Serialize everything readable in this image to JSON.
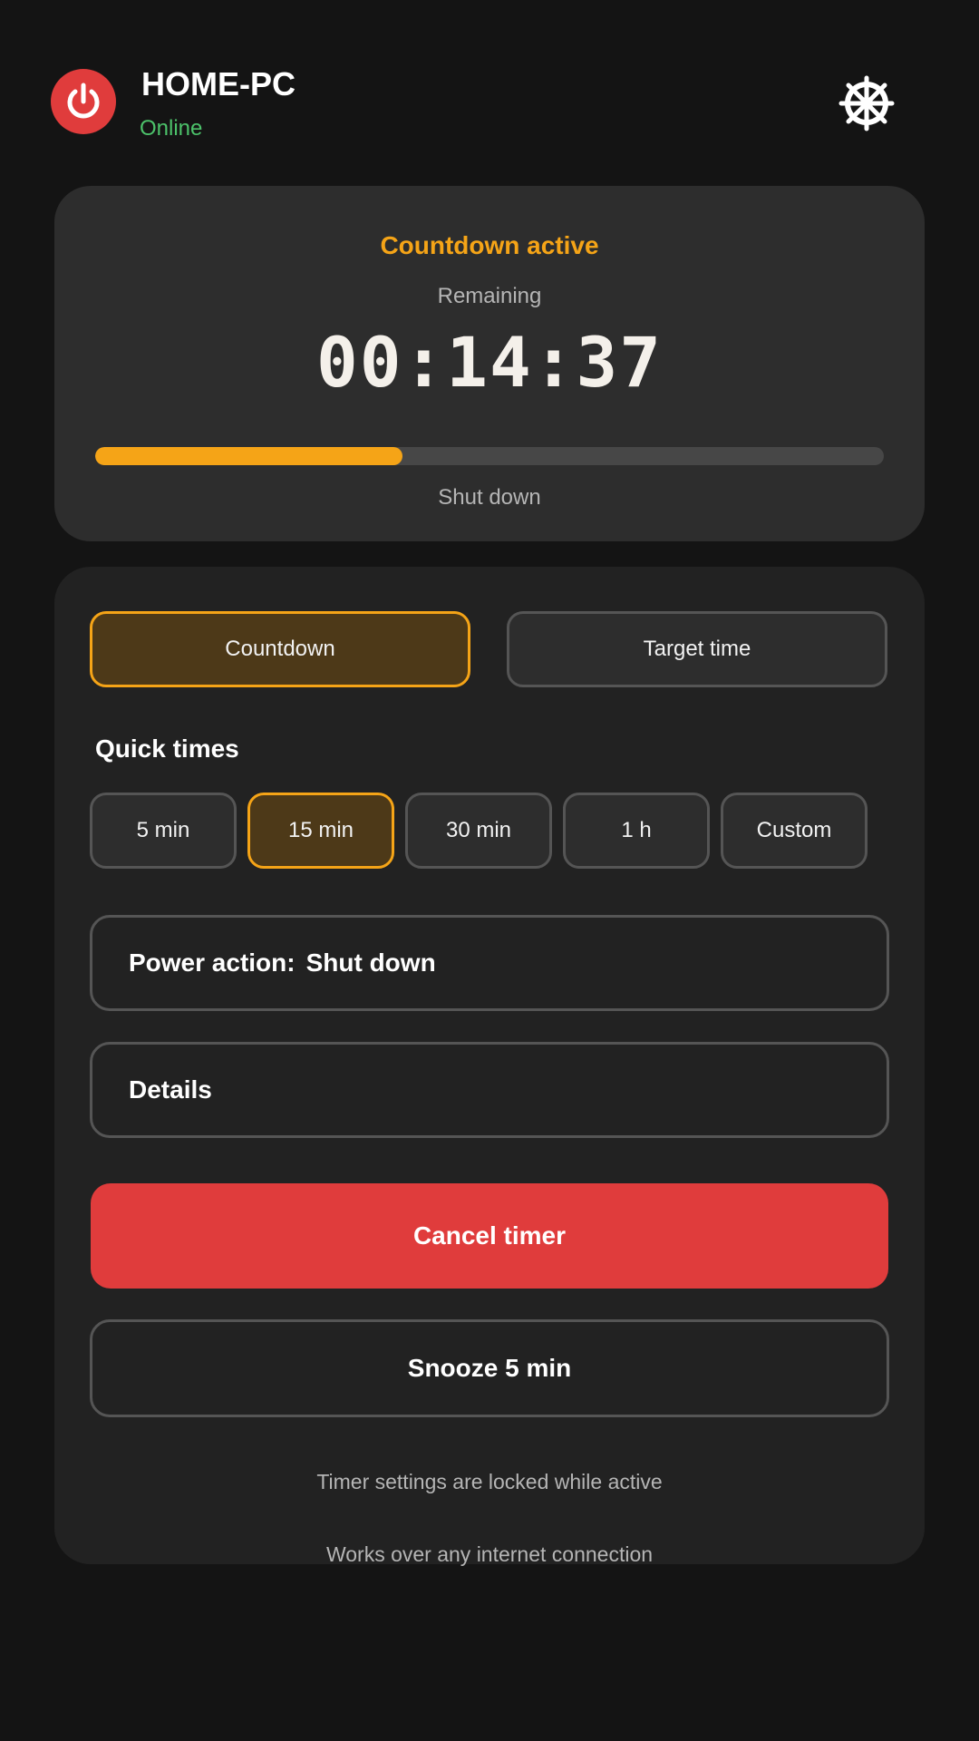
{
  "header": {
    "device_name": "HOME-PC",
    "status": "Online",
    "power_icon": "power-icon",
    "settings_icon": "gear-icon"
  },
  "status_card": {
    "title": "Countdown active",
    "remaining_label": "Remaining",
    "time": "00:14:37",
    "progress_percent": 39,
    "action": "Shut down"
  },
  "mode_tabs": [
    {
      "label": "Countdown",
      "selected": true
    },
    {
      "label": "Target time",
      "selected": false
    }
  ],
  "quick_times": {
    "title": "Quick times",
    "options": [
      {
        "label": "5 min",
        "selected": false
      },
      {
        "label": "15 min",
        "selected": true
      },
      {
        "label": "30 min",
        "selected": false
      },
      {
        "label": "1 h",
        "selected": false
      },
      {
        "label": "Custom",
        "selected": false
      }
    ]
  },
  "power_action": {
    "label": "Power action:",
    "value": "Shut down"
  },
  "details": {
    "label": "Details"
  },
  "buttons": {
    "cancel": "Cancel timer",
    "snooze": "Snooze 5 min"
  },
  "notes": {
    "locked": "Timer settings are locked while active",
    "connection": "Works over any internet connection"
  },
  "colors": {
    "accent": "#f5a417",
    "danger": "#e03c3c",
    "online": "#4cc26a",
    "background": "#141414"
  }
}
